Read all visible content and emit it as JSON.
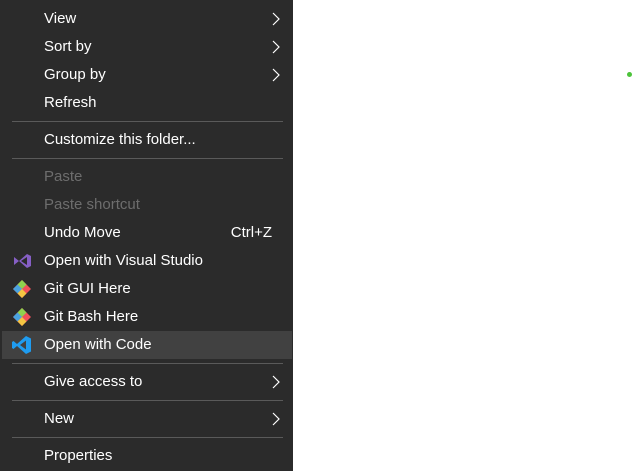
{
  "menu": {
    "items": [
      {
        "label": "View",
        "submenu": true
      },
      {
        "label": "Sort by",
        "submenu": true
      },
      {
        "label": "Group by",
        "submenu": true
      },
      {
        "label": "Refresh"
      },
      {
        "label": "Customize this folder..."
      },
      {
        "label": "Paste",
        "disabled": true
      },
      {
        "label": "Paste shortcut",
        "disabled": true
      },
      {
        "label": "Undo Move",
        "shortcut": "Ctrl+Z"
      },
      {
        "label": "Open with Visual Studio",
        "icon": "visual-studio-icon"
      },
      {
        "label": "Git GUI Here",
        "icon": "git-icon"
      },
      {
        "label": "Git Bash Here",
        "icon": "git-icon"
      },
      {
        "label": "Open with Code",
        "icon": "vscode-icon",
        "highlighted": true
      },
      {
        "label": "Give access to",
        "submenu": true
      },
      {
        "label": "New",
        "submenu": true
      },
      {
        "label": "Properties"
      }
    ]
  },
  "colors": {
    "menu_bg": "#2b2b2b",
    "hover_bg": "#414141",
    "text": "#ffffff",
    "disabled_text": "#6d6d6d",
    "visual_studio": "#865fc5",
    "vscode": "#1f9cf0",
    "desktop_bg": "#ffffff",
    "status_dot": "#4cc33a"
  }
}
